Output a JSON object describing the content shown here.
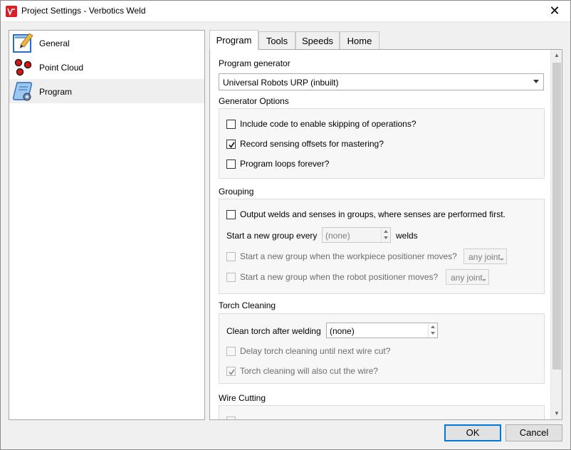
{
  "window": {
    "title": "Project Settings - Verbotics Weld",
    "close_glyph": "✕",
    "brand_color": "#d6202a"
  },
  "nav": {
    "items": [
      {
        "label": "General",
        "icon": "pencil-paper-icon",
        "selected": false
      },
      {
        "label": "Point Cloud",
        "icon": "point-cloud-icon",
        "selected": false
      },
      {
        "label": "Program",
        "icon": "program-scroll-icon",
        "selected": true
      }
    ]
  },
  "tabs": [
    {
      "label": "Program",
      "active": true
    },
    {
      "label": "Tools",
      "active": false
    },
    {
      "label": "Speeds",
      "active": false
    },
    {
      "label": "Home",
      "active": false
    }
  ],
  "program": {
    "generator_label": "Program generator",
    "generator_value": "Universal Robots URP (inbuilt)",
    "generator_options_title": "Generator Options",
    "options": [
      {
        "label": "Include code to enable skipping of operations?",
        "checked": false
      },
      {
        "label": "Record sensing offsets for mastering?",
        "checked": true
      },
      {
        "label": "Program loops forever?",
        "checked": false
      }
    ],
    "grouping": {
      "title": "Grouping",
      "output_groups_label": "Output welds and senses in groups, where senses are performed first.",
      "output_groups_checked": false,
      "new_group_label": "Start a new group every",
      "new_group_value": "(none)",
      "new_group_unit": "welds",
      "workpiece_label": "Start a new group when the workpiece positioner moves?",
      "workpiece_combo": "any joint",
      "robot_label": "Start a new group when the robot positioner moves?",
      "robot_combo": "any joint"
    },
    "torch_cleaning": {
      "title": "Torch Cleaning",
      "clean_label": "Clean torch after welding",
      "clean_value": "(none)",
      "delay_label": "Delay torch cleaning until next wire cut?",
      "delay_checked": false,
      "cut_label": "Torch cleaning will also cut the wire?",
      "cut_checked": true
    },
    "wire_cutting": {
      "title": "Wire Cutting"
    }
  },
  "buttons": {
    "ok": "OK",
    "cancel": "Cancel"
  }
}
